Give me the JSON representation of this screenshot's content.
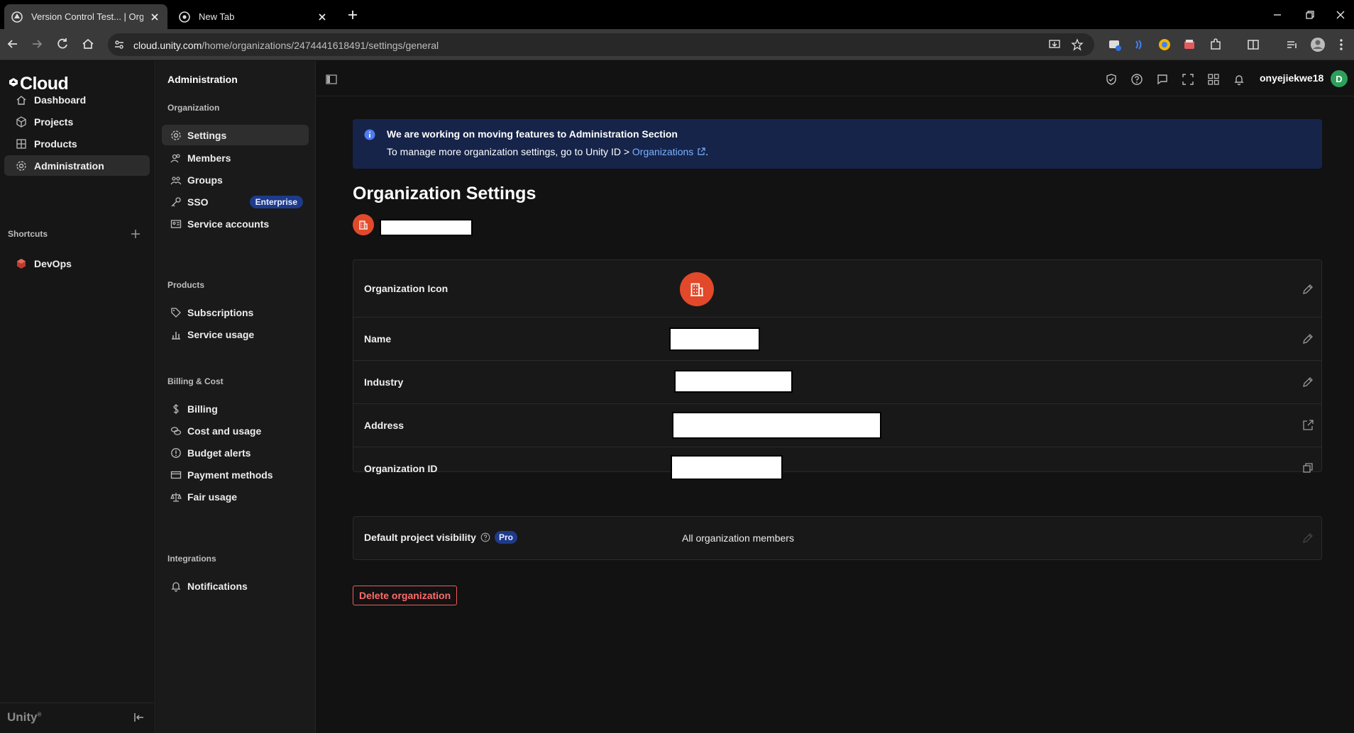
{
  "browser": {
    "tabs": [
      {
        "title": "Version Control Test... | Organiz",
        "active": true
      },
      {
        "title": "New Tab",
        "active": false
      }
    ],
    "url_host": "cloud.unity.com",
    "url_path": "/home/organizations/2474441618491/settings/general"
  },
  "leftnav": {
    "logo": "Cloud",
    "items": [
      {
        "label": "Dashboard",
        "icon": "home-icon"
      },
      {
        "label": "Projects",
        "icon": "cube-icon"
      },
      {
        "label": "Products",
        "icon": "grid-icon"
      },
      {
        "label": "Administration",
        "icon": "gear-icon",
        "active": true
      }
    ],
    "shortcuts_label": "Shortcuts",
    "shortcuts": [
      {
        "label": "DevOps",
        "icon": "devops-icon"
      }
    ],
    "footer": "Unity"
  },
  "subnav": {
    "title": "Administration",
    "sections": [
      {
        "label": "Organization",
        "items": [
          "Settings",
          "Members",
          "Groups",
          "SSO",
          "Service accounts"
        ]
      },
      {
        "label": "Products",
        "items": [
          "Subscriptions",
          "Service usage"
        ]
      },
      {
        "label": "Billing & Cost",
        "items": [
          "Billing",
          "Cost and usage",
          "Budget alerts",
          "Payment methods",
          "Fair usage"
        ]
      },
      {
        "label": "Integrations",
        "items": [
          "Notifications"
        ]
      }
    ],
    "sso_badge": "Enterprise"
  },
  "header": {
    "username": "onyejiekwe18",
    "avatar_letter": "D"
  },
  "banner": {
    "title": "We are working on moving features to Administration Section",
    "text": "To manage more organization settings, go to Unity ID > ",
    "link": "Organizations",
    "suffix": "."
  },
  "page": {
    "title": "Organization Settings",
    "rows": [
      {
        "label": "Organization Icon",
        "action": "edit"
      },
      {
        "label": "Name",
        "action": "edit"
      },
      {
        "label": "Industry",
        "action": "edit"
      },
      {
        "label": "Address",
        "action": "external-link"
      },
      {
        "label": "Organization ID",
        "action": "copy"
      }
    ],
    "visibility": {
      "label": "Default project visibility",
      "badge": "Pro",
      "value": "All organization members"
    },
    "delete_label": "Delete organization"
  },
  "colors": {
    "accent": "#e2492a",
    "banner": "#16244a",
    "link": "#7ab2ff",
    "danger": "#ef5b5b"
  }
}
